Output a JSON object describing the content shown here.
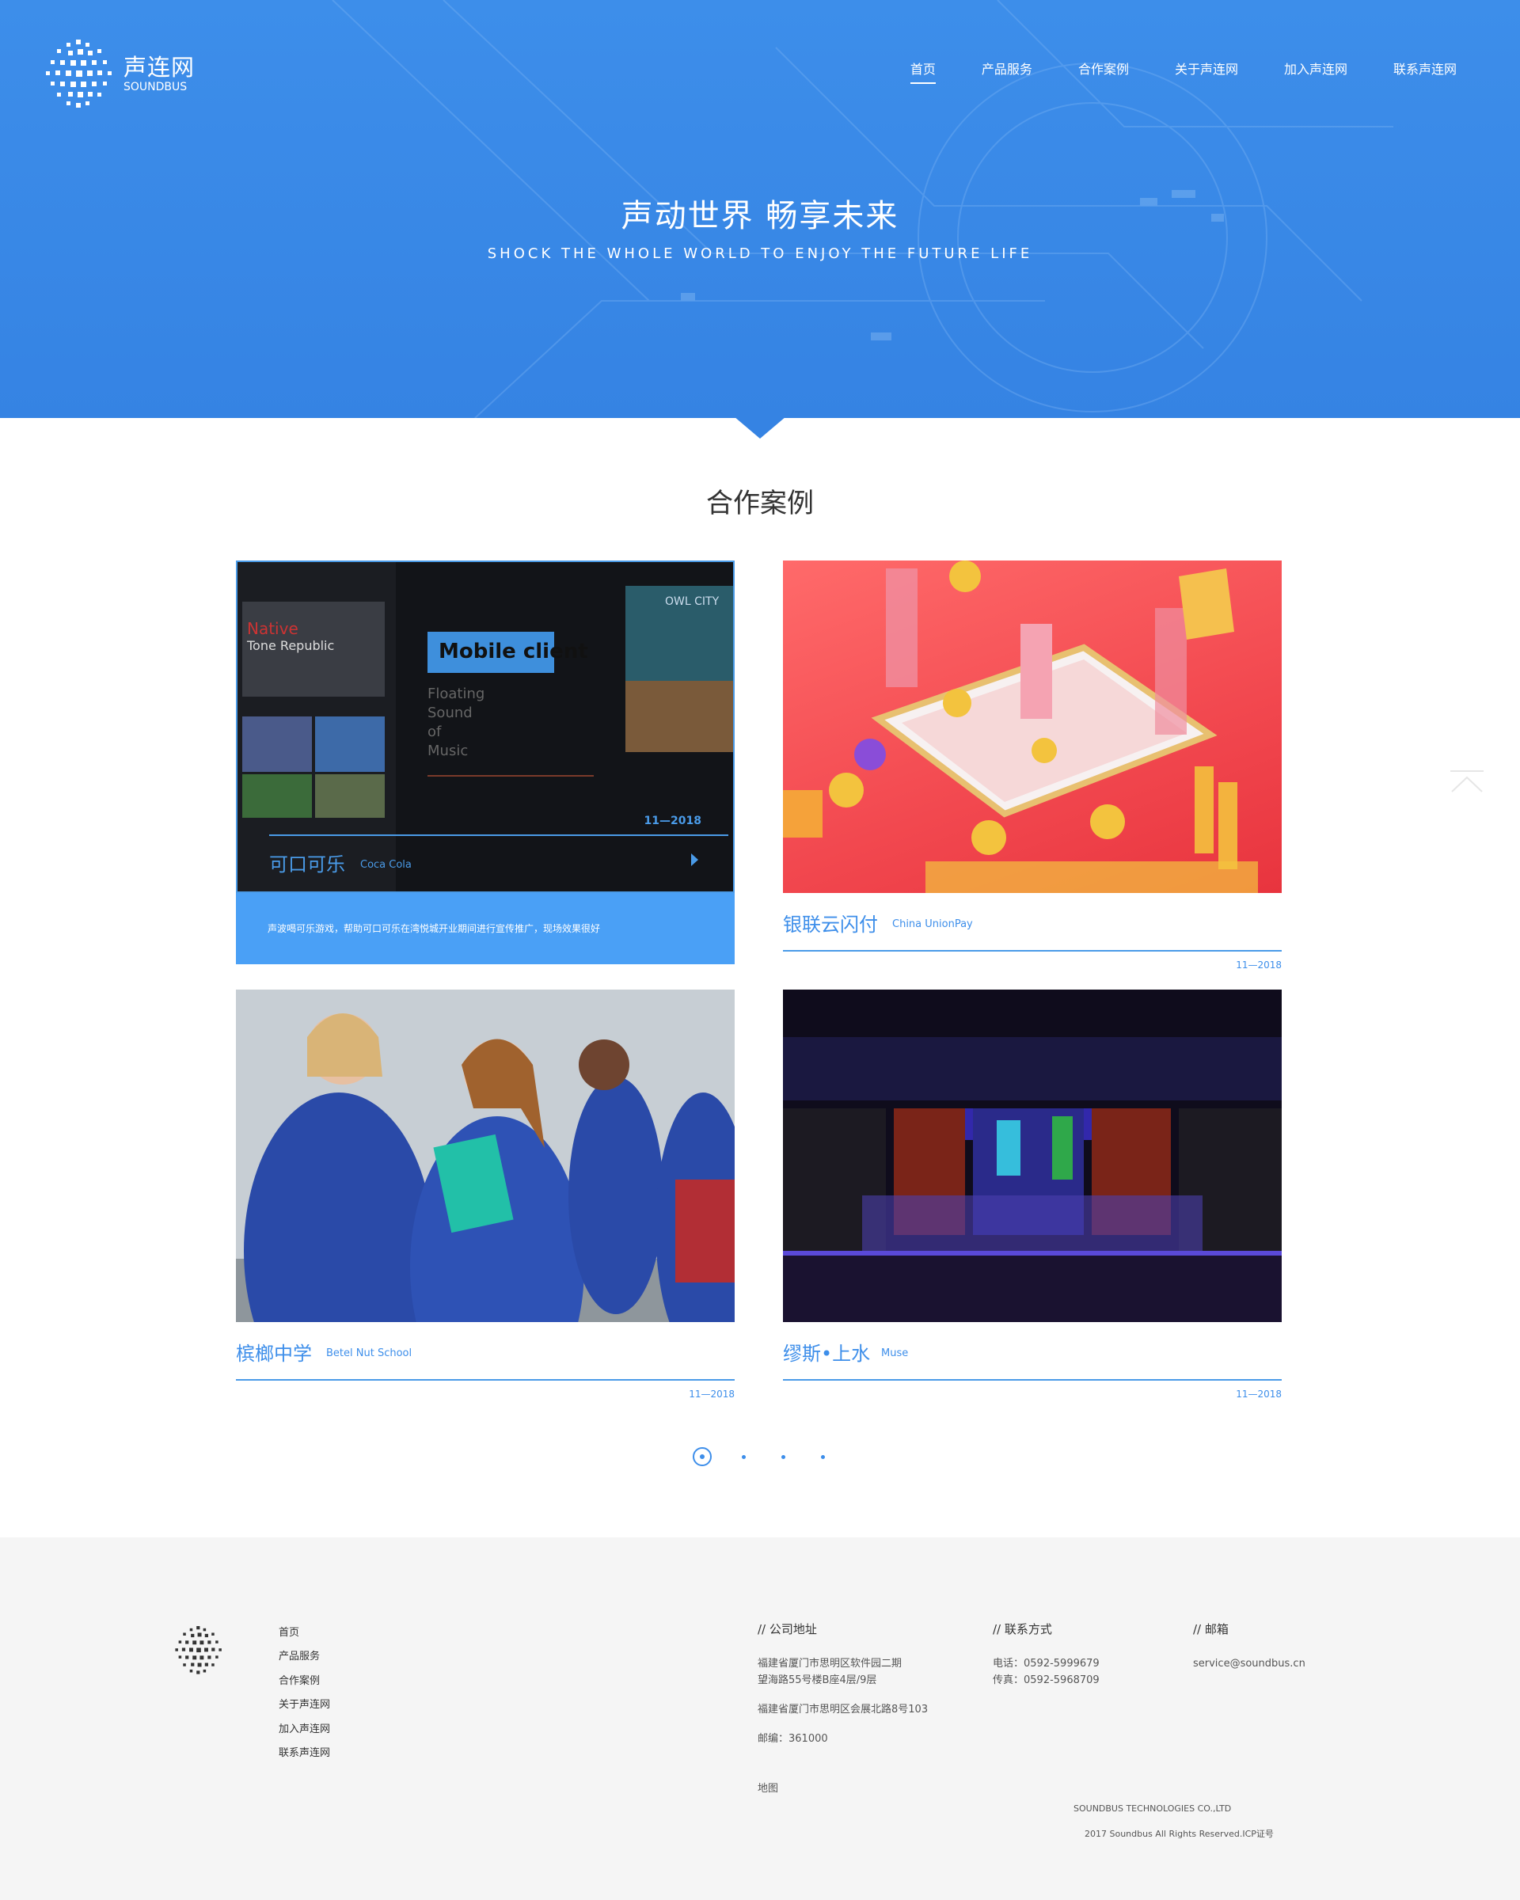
{
  "brand": {
    "name_cn": "声连网",
    "name_en": "SOUNDBUS"
  },
  "nav": {
    "items": [
      {
        "label": "首页",
        "active": true
      },
      {
        "label": "产品服务",
        "active": false
      },
      {
        "label": "合作案例",
        "active": false
      },
      {
        "label": "关于声连网",
        "active": false
      },
      {
        "label": "加入声连网",
        "active": false
      },
      {
        "label": "联系声连网",
        "active": false
      }
    ]
  },
  "hero": {
    "title": "声动世界 畅享未来",
    "subtitle": "SHOCK THE WHOLE WORLD TO  ENJOY  THE  FUTURE  LIFE"
  },
  "section": {
    "title": "合作案例"
  },
  "cases": [
    {
      "name_cn": "可口可乐",
      "name_en": "Coca Cola",
      "date": "11—2018",
      "description": "声波喝可乐游戏，帮助可口可乐在湾悦城开业期间进行宣传推广，现场效果很好",
      "image_text": {
        "label": "Mobile client",
        "lines": [
          "Floating",
          "Sound",
          "of",
          "Music"
        ],
        "app_title": "Native",
        "app_subtitle": "Tone Republic",
        "right_title": "OWL CITY"
      }
    },
    {
      "name_cn": "银联云闪付",
      "name_en": "China UnionPay",
      "date": "11—2018"
    },
    {
      "name_cn": "槟榔中学",
      "name_en": "Betel Nut School",
      "date": "11—2018"
    },
    {
      "name_cn": "缪斯•上水",
      "name_en": "Muse",
      "date": "11—2018"
    }
  ],
  "pagination": {
    "total": 4,
    "current": 1
  },
  "footer": {
    "nav": [
      "首页",
      "产品服务",
      "合作案例",
      "关于声连网",
      "加入声连网",
      "联系声连网"
    ],
    "address": {
      "heading": "// 公司地址",
      "line1": "福建省厦门市思明区软件园二期",
      "line2": "望海路55号楼B座4层/9层",
      "line3": "福建省厦门市思明区会展北路8号103",
      "postcode": "邮编：361000"
    },
    "contact": {
      "heading": "// 联系方式",
      "phone": "电话：0592-5999679",
      "fax": "传真：0592-5968709"
    },
    "email": {
      "heading": "// 邮箱",
      "value": "service@soundbus.cn"
    },
    "map_link": "地图",
    "company": "SOUNDBUS TECHNOLOGIES CO.,LTD",
    "copyright": "2017 Soundbus All Rights Reserved.ICP证号"
  },
  "colors": {
    "primary": "#3d8eea",
    "hero_bg": "#3583e3",
    "footer_bg": "#f5f5f5",
    "desc_bg": "#4aa0f6"
  }
}
